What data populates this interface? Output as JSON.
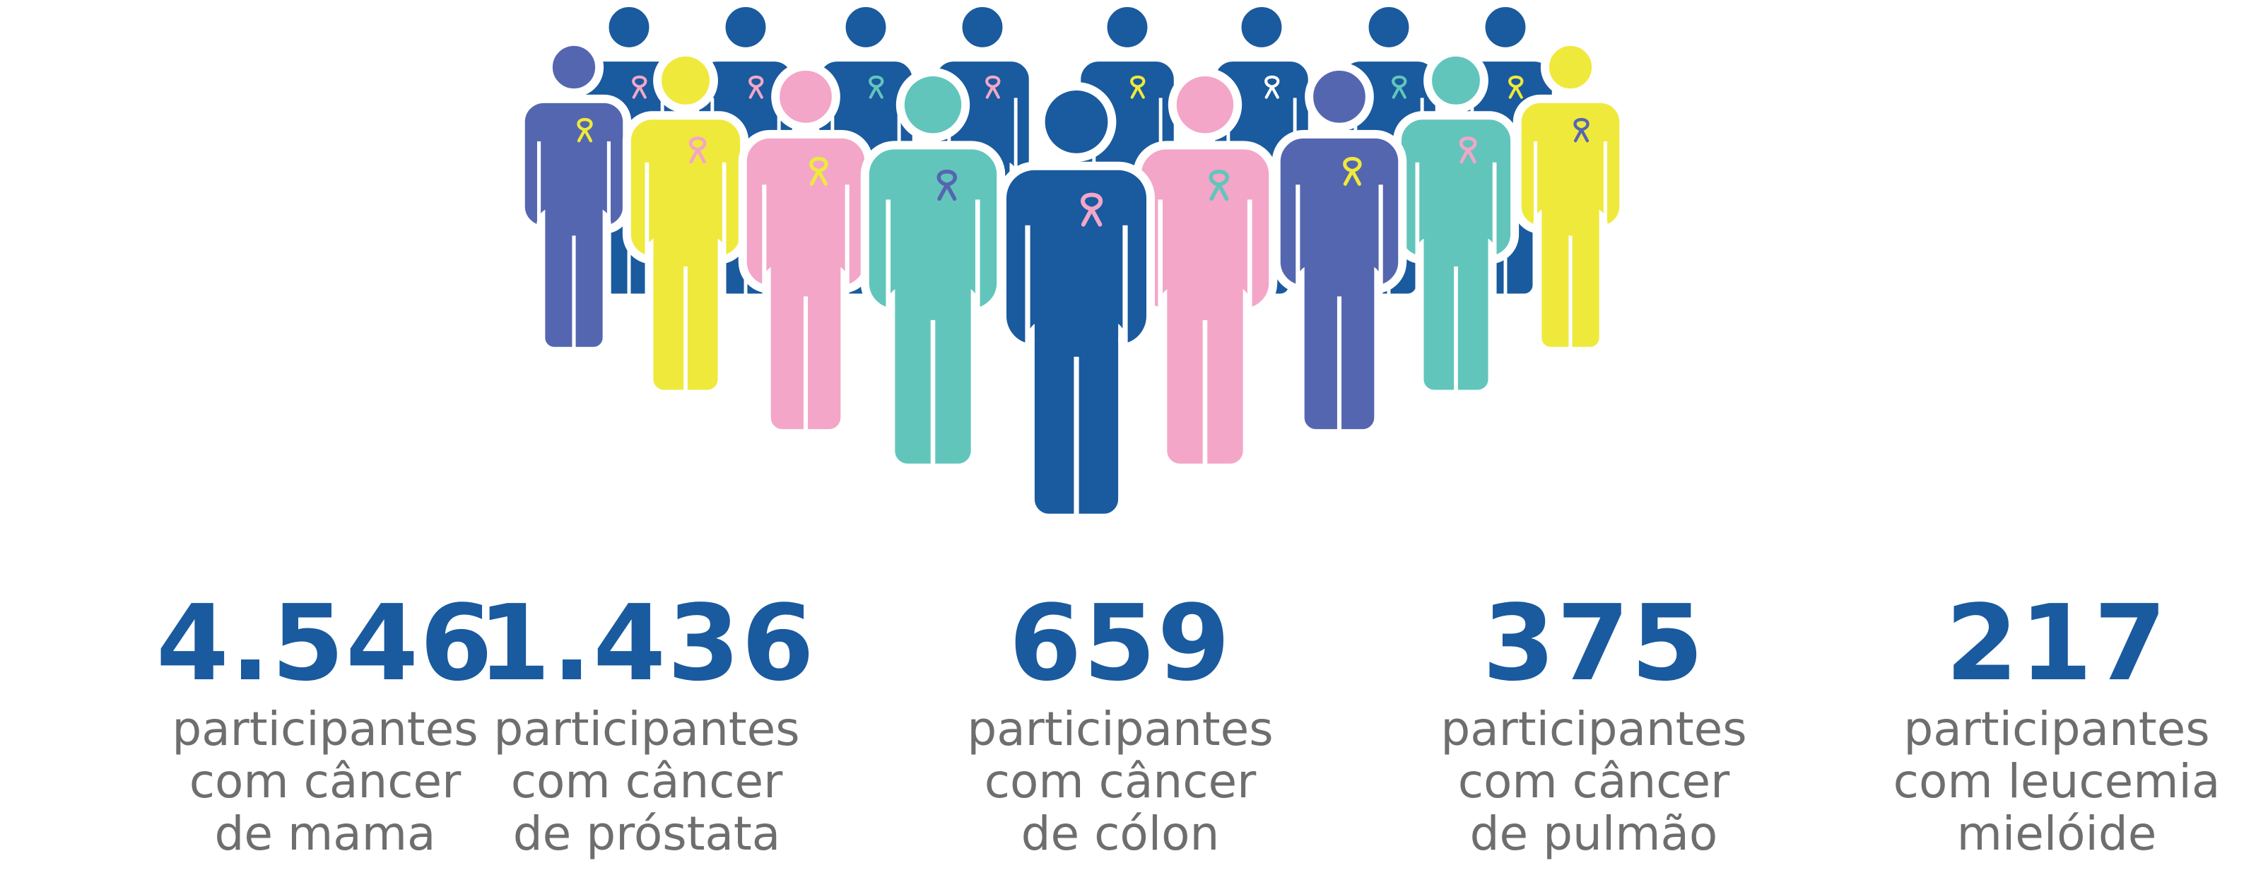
{
  "colors": {
    "blue": "#1a5a9e",
    "purple": "#5566b0",
    "yellow": "#efe93c",
    "pink": "#f3a6c8",
    "teal": "#62c5bc",
    "text_gray": "#6e6e6e"
  },
  "stats": [
    {
      "number": "4.546",
      "line1": "participantes",
      "line2": "com câncer",
      "line3": "de mama"
    },
    {
      "number": "1.436",
      "line1": "participantes",
      "line2": "com câncer",
      "line3": "de próstata"
    },
    {
      "number": "659",
      "line1": "participantes",
      "line2": "com câncer",
      "line3": "de cólon"
    },
    {
      "number": "375",
      "line1": "participantes",
      "line2": "com câncer",
      "line3": "de pulmão"
    },
    {
      "number": "217",
      "line1": "participantes",
      "line2": "com leucemia",
      "line3": "mielóide"
    }
  ]
}
